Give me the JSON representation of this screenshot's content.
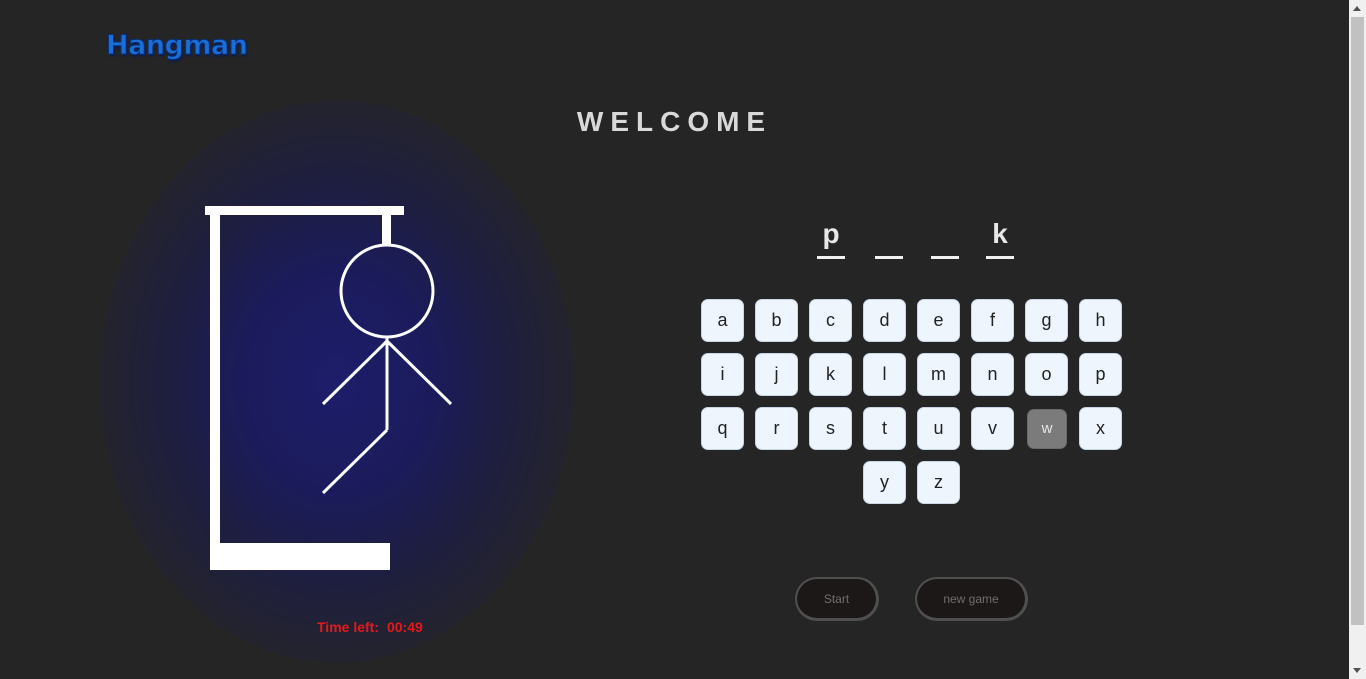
{
  "app": {
    "logo": "Hangman"
  },
  "header": {
    "title": "WELCOME"
  },
  "timer": {
    "label": "Time left:",
    "value": "00:49"
  },
  "word": {
    "letters": [
      "p",
      "",
      "",
      "k"
    ]
  },
  "keyboard": {
    "keys": [
      {
        "letter": "a",
        "used": false
      },
      {
        "letter": "b",
        "used": false
      },
      {
        "letter": "c",
        "used": false
      },
      {
        "letter": "d",
        "used": false
      },
      {
        "letter": "e",
        "used": false
      },
      {
        "letter": "f",
        "used": false
      },
      {
        "letter": "g",
        "used": false
      },
      {
        "letter": "h",
        "used": false
      },
      {
        "letter": "i",
        "used": false
      },
      {
        "letter": "j",
        "used": false
      },
      {
        "letter": "k",
        "used": false
      },
      {
        "letter": "l",
        "used": false
      },
      {
        "letter": "m",
        "used": false
      },
      {
        "letter": "n",
        "used": false
      },
      {
        "letter": "o",
        "used": false
      },
      {
        "letter": "p",
        "used": false
      },
      {
        "letter": "q",
        "used": false
      },
      {
        "letter": "r",
        "used": false
      },
      {
        "letter": "s",
        "used": false
      },
      {
        "letter": "t",
        "used": false
      },
      {
        "letter": "u",
        "used": false
      },
      {
        "letter": "v",
        "used": false
      },
      {
        "letter": "w",
        "used": true
      },
      {
        "letter": "x",
        "used": false
      },
      {
        "letter": "y",
        "used": false
      },
      {
        "letter": "z",
        "used": false
      }
    ]
  },
  "controls": {
    "start_label": "Start",
    "new_game_label": "new game"
  },
  "hangman": {
    "parts_drawn": [
      "head",
      "body",
      "left-arm",
      "right-arm",
      "left-leg"
    ]
  },
  "colors": {
    "logo": "#1a6fd6",
    "timer": "#e41a1a",
    "background": "#252525",
    "key_bg": "#eef5fd",
    "key_used": "#7b7b7b"
  }
}
